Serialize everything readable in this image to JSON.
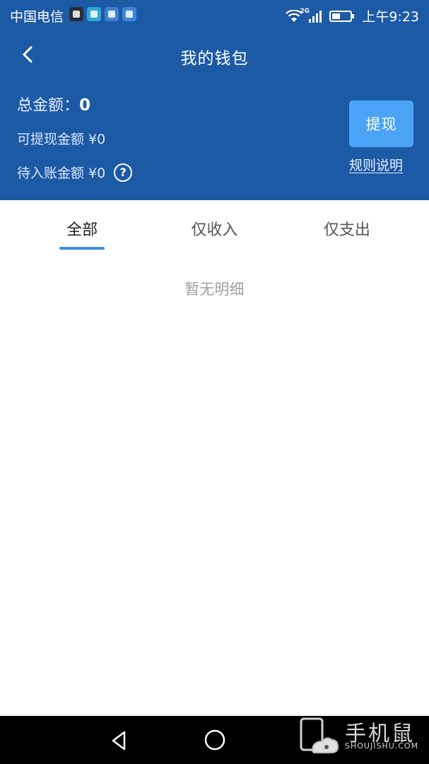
{
  "status_bar": {
    "carrier": "中国电信",
    "network_type": "2G",
    "time": "上午9:23"
  },
  "nav": {
    "title": "我的钱包"
  },
  "summary": {
    "total_label": "总金额：",
    "total_value": "0",
    "withdrawable": "可提现金额 ¥0",
    "pending": "待入账金额 ¥0",
    "help_symbol": "?"
  },
  "actions": {
    "withdraw_label": "提现",
    "rules_label": "规则说明"
  },
  "tabs": [
    {
      "label": "全部",
      "active": true
    },
    {
      "label": "仅收入",
      "active": false
    },
    {
      "label": "仅支出",
      "active": false
    }
  ],
  "empty_state": {
    "text": "暂无明细"
  },
  "watermark": {
    "main": "手机鼠",
    "sub": "SHOUJISHU.COM"
  },
  "colors": {
    "header_blue": "#1c5aa6",
    "withdraw_button": "#4aa3f5",
    "tab_indicator": "#3a8fe8",
    "empty_text": "#a0a0a0"
  },
  "icons": {
    "back": "chevron-left-icon",
    "help": "question-circle-icon",
    "wifi": "wifi-icon",
    "signal": "signal-icon",
    "battery": "battery-icon",
    "nav_back": "triangle-back-icon",
    "nav_home": "circle-home-icon"
  }
}
